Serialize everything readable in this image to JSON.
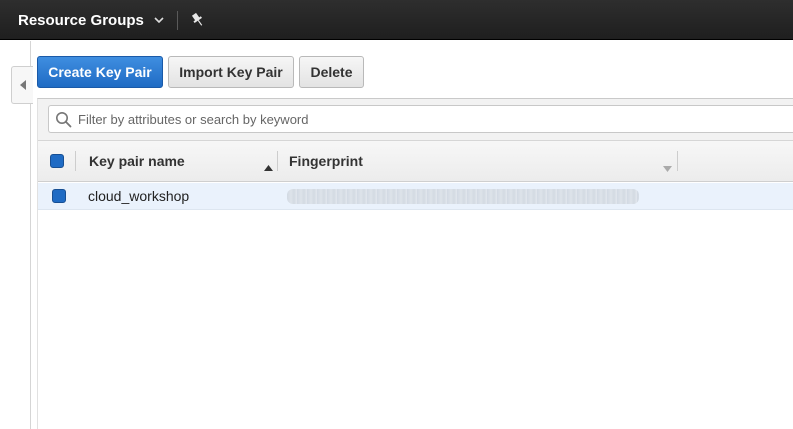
{
  "topbar": {
    "resource_groups_label": "Resource Groups"
  },
  "toolbar": {
    "create_label": "Create Key Pair",
    "import_label": "Import Key Pair",
    "delete_label": "Delete"
  },
  "filter": {
    "placeholder": "Filter by attributes or search by keyword"
  },
  "table": {
    "columns": [
      {
        "label": "Key pair name",
        "sort": "ascending"
      },
      {
        "label": "Fingerprint",
        "sort": "none"
      }
    ],
    "rows": [
      {
        "name": "cloud_workshop",
        "fingerprint_blurred": true,
        "selected": true
      }
    ]
  },
  "colors": {
    "topbar_bg": "#232323",
    "primary_button": "#1f6bc4",
    "selected_row_bg": "#eaf2fc",
    "checkbox": "#1f6bc4"
  },
  "icons": {
    "resource_groups_caret": "chevron-down-icon",
    "pin": "pin-icon",
    "sidebar_toggle": "caret-left-icon",
    "search": "search-icon",
    "sort_name": "sort-ascending-icon",
    "sort_fingerprint": "sort-descending-icon"
  }
}
